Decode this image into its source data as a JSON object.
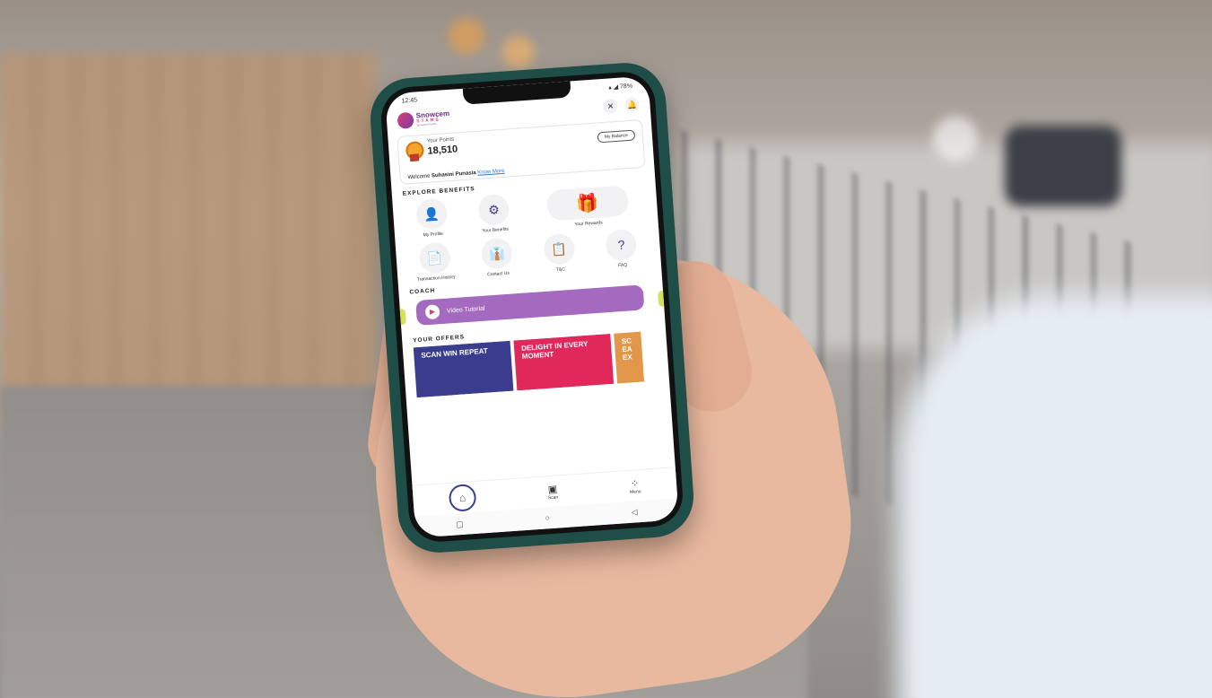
{
  "status": {
    "time": "12:45",
    "indicators": "▴ ◢ 78%"
  },
  "app": {
    "brand": "Snowcem",
    "tagline": "STARS",
    "byline": "Snowcem Paints"
  },
  "points": {
    "label": "Your Points",
    "value": "18,510",
    "balance_button": "My Balance"
  },
  "welcome": {
    "prefix": "Welcome",
    "name": "Suhasini Punasia",
    "link": "Know More"
  },
  "explore": {
    "title": "EXPLORE BENEFITS",
    "items": [
      {
        "label": "My Profile",
        "icon": "user-icon"
      },
      {
        "label": "Your Benefits",
        "icon": "benefits-icon"
      },
      {
        "label": "Your Rewards",
        "icon": "gift-icon"
      },
      {
        "label": "Transaction History",
        "icon": "document-check-icon"
      },
      {
        "label": "Contact Us",
        "icon": "support-agent-icon"
      },
      {
        "label": "T&C",
        "icon": "terms-icon"
      },
      {
        "label": "FAQ",
        "icon": "faq-icon"
      }
    ]
  },
  "coach": {
    "title": "COACH",
    "button": "Video Tutorial"
  },
  "offers": {
    "title": "YOUR OFFERS",
    "cards": [
      {
        "text": "SCAN WIN REPEAT"
      },
      {
        "text": "DELIGHT IN EVERY MOMENT"
      },
      {
        "text": "SC EA EX"
      }
    ]
  },
  "nav": {
    "scan": "Scan",
    "menu": "Menu"
  },
  "colors": {
    "phone_case": "#1f4d47",
    "brand_purple": "#6b2d8f",
    "brand_pink": "#d93b7b",
    "coach_button": "#a46ac0",
    "offer_blue": "#3a3d8d",
    "offer_pink": "#e0285a"
  }
}
